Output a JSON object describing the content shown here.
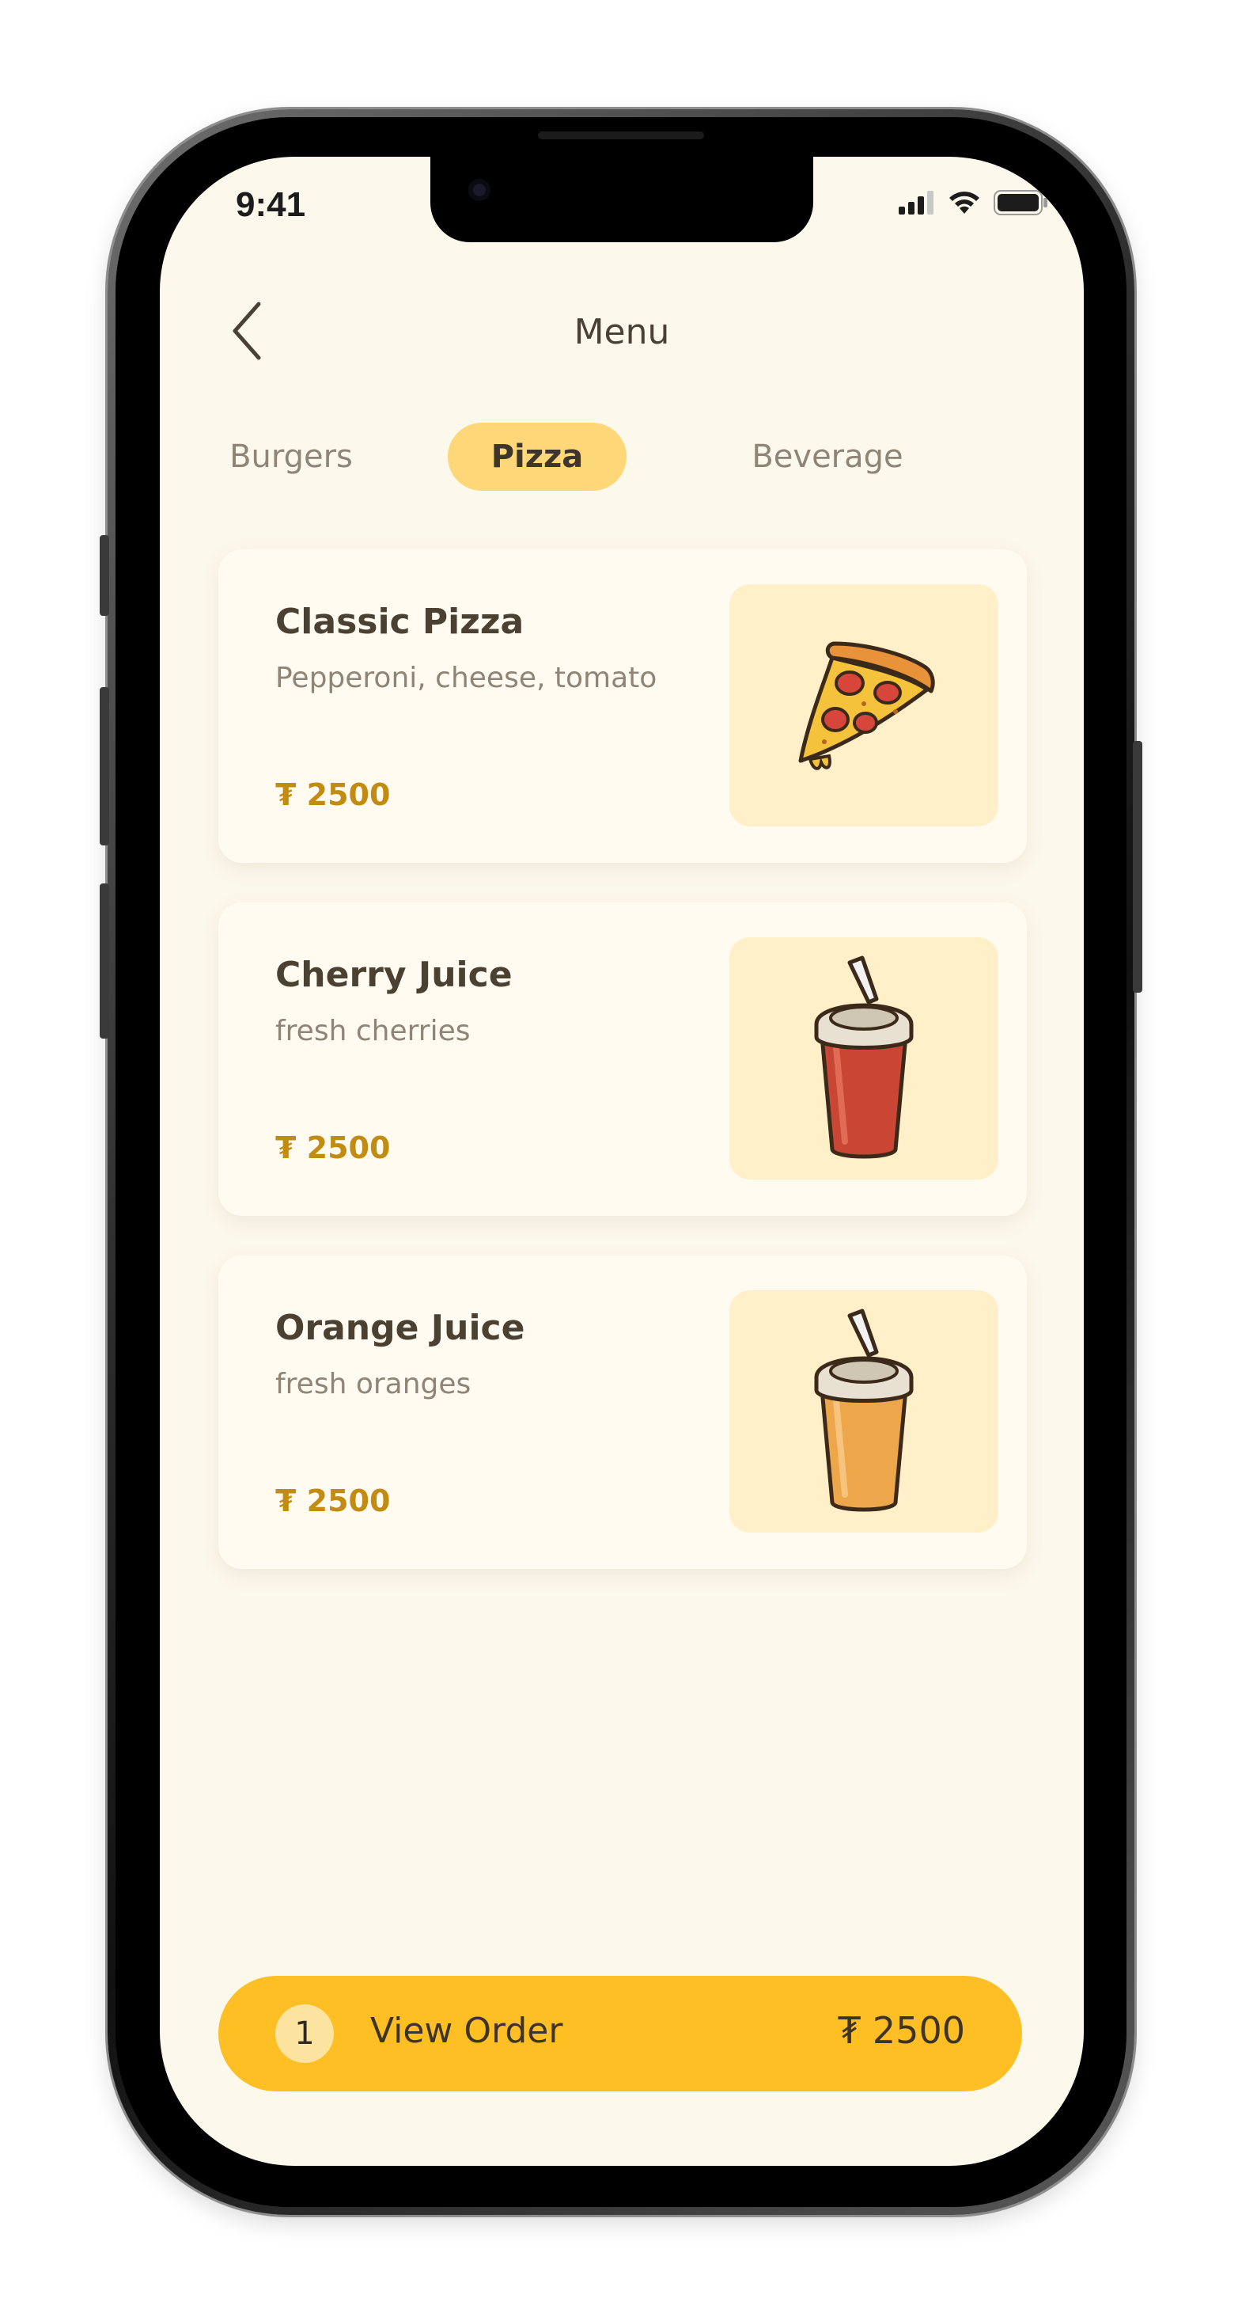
{
  "status_bar": {
    "time": "9:41",
    "icons": [
      "signal-icon",
      "wifi-icon",
      "battery-icon"
    ]
  },
  "header": {
    "title": "Menu",
    "back_icon": "chevron-left-icon"
  },
  "tabs": [
    {
      "label": "Burgers",
      "active": false
    },
    {
      "label": "Pizza",
      "active": true
    },
    {
      "label": "Beverage",
      "active": false
    }
  ],
  "menu_items": [
    {
      "name": "Classic Pizza",
      "description": "Pepperoni, cheese, tomato",
      "price": "₮ 2500",
      "icon": "pizza-slice-icon"
    },
    {
      "name": "Cherry Juice",
      "description": "fresh cherries",
      "price": "₮ 2500",
      "icon": "cherry-juice-cup-icon"
    },
    {
      "name": "Orange Juice",
      "description": "fresh oranges",
      "price": "₮ 2500",
      "icon": "orange-juice-cup-icon"
    }
  ],
  "order_bar": {
    "count": "1",
    "label": "View Order",
    "total": "₮ 2500"
  },
  "colors": {
    "background": "#fdf8ec",
    "accent": "#fdbf24",
    "active_tab": "#fdd778",
    "price": "#c28b12",
    "card_image_bg": "#fff0c9"
  }
}
